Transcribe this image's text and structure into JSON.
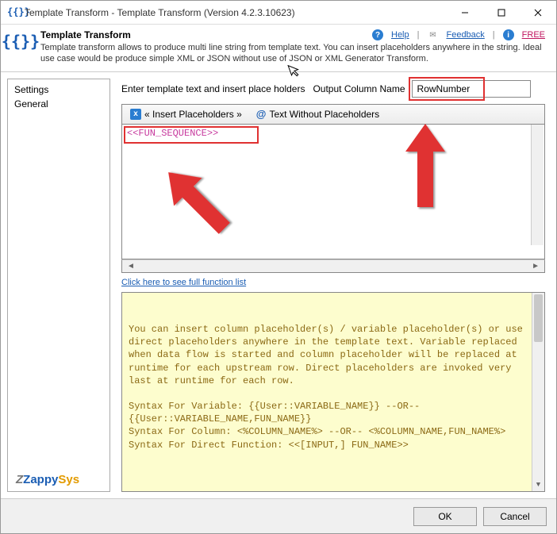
{
  "window": {
    "title": "Template Transform - Template Transform (Version 4.2.3.10623)",
    "app_icon": "{{}}"
  },
  "header": {
    "big_icon": "{{}}",
    "name": "Template Transform",
    "description": "Template transform allows to produce multi line string from template text. You can insert placeholders anywhere in the string. Ideal use case would be produce simple XML or JSON without use of JSON or XML Generator Transform.",
    "links": {
      "help": "Help",
      "feedback": "Feedback",
      "free": "FREE"
    }
  },
  "sidebar": {
    "items": [
      {
        "label": "Settings"
      },
      {
        "label": "General"
      }
    ],
    "logo": {
      "z": "Z",
      "zappy": "Zappy",
      "sys": "Sys"
    }
  },
  "settings": {
    "template_label": "Enter template text and insert place holders",
    "output_label": "Output Column Name",
    "output_value": "RowNumber",
    "toolbar": {
      "insert_placeholders": "« Insert Placeholders »",
      "text_without": "Text Without Placeholders"
    },
    "editor_text": "<<FUN_SEQUENCE>>",
    "function_list_link": "Click here to see full function list",
    "help_text": "You can insert column placeholder(s) / variable placeholder(s) or use direct placeholders anywhere in the template text. Variable replaced when data flow is started and column placeholder will be replaced at runtime for each upstream row. Direct placeholders are invoked very last at runtime for each row.\n\nSyntax For Variable: {{User::VARIABLE_NAME}} --OR-- {{User::VARIABLE_NAME,FUN_NAME}}\nSyntax For Column: <%COLUMN_NAME%> --OR-- <%COLUMN_NAME,FUN_NAME%>\nSyntax For Direct Function: <<[INPUT,] FUN_NAME>>"
  },
  "footer": {
    "ok": "OK",
    "cancel": "Cancel"
  },
  "scroll": {
    "left": "◄",
    "right": "►",
    "up": "▲",
    "down": "▼"
  }
}
